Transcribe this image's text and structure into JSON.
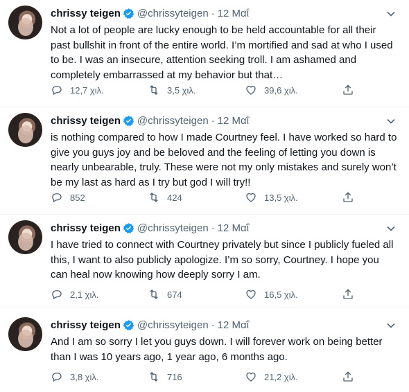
{
  "tweets": [
    {
      "name": "chrissy teigen",
      "handle": "@chrissyteigen",
      "separator": "·",
      "date": "12 Μαΐ",
      "text": "Not a lot of people are lucky enough to be held accountable for all their past bullshit in front of the entire world. I’m mortified and sad at who I used to be. I was an insecure, attention seeking troll. I am ashamed and completely embarrassed at my behavior but that…",
      "replies": "12,7 χιλ.",
      "retweets": "3,5 χιλ.",
      "likes": "39,6 χιλ."
    },
    {
      "name": "chrissy teigen",
      "handle": "@chrissyteigen",
      "separator": "·",
      "date": "12 Μαΐ",
      "text": "is nothing compared to how I made Courtney feel. I have worked so hard to give you guys joy and be beloved and the feeling of letting you down is nearly unbearable, truly. These were not my only mistakes and surely won’t be my last as hard as I try but god I will try!!",
      "replies": "852",
      "retweets": "424",
      "likes": "13,5 χιλ."
    },
    {
      "name": "chrissy teigen",
      "handle": "@chrissyteigen",
      "separator": "·",
      "date": "12 Μαΐ",
      "text": "I have tried to connect with Courtney privately but since I publicly fueled all this, I want to also publicly apologize. I’m so sorry, Courtney. I hope you can heal now knowing how deeply sorry I am.",
      "replies": "2,1 χιλ.",
      "retweets": "674",
      "likes": "16,5 χιλ."
    },
    {
      "name": "chrissy teigen",
      "handle": "@chrissyteigen",
      "separator": "·",
      "date": "12 Μαΐ",
      "text": "And I am so sorry I let you guys down. I will forever work on being better than I was 10 years ago, 1 year ago, 6 months ago.",
      "replies": "3,8 χιλ.",
      "retweets": "716",
      "likes": "21,2 χιλ."
    }
  ],
  "icons": {
    "verified": "verified-badge-icon",
    "more": "chevron-down-icon",
    "reply": "reply-icon",
    "retweet": "retweet-icon",
    "like": "heart-icon",
    "share": "share-icon"
  },
  "colors": {
    "text": "#0f1419",
    "secondary": "#536471",
    "verified": "#1d9bf0",
    "divider": "#eff3f4"
  }
}
